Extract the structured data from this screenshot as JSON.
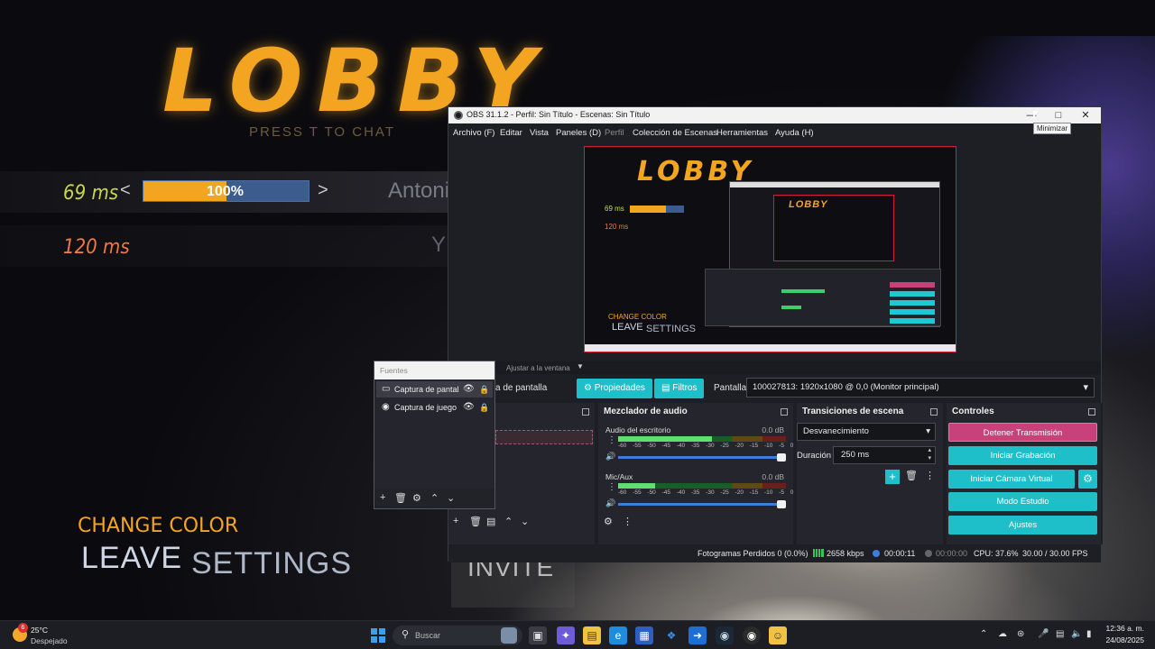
{
  "game": {
    "title": "LOBBY",
    "press_chat": "PRESS T TO CHAT",
    "ping1": "69 ms",
    "ping2": "120 ms",
    "volume_text": "100%",
    "volume_fraction": 0.5,
    "player1": "Antoni",
    "player2": "Y",
    "change_color": "CHANGE COLOR",
    "leave": "LEAVE",
    "settings": "SETTINGS",
    "invite": "INVITE",
    "accent_color": "#f3a521"
  },
  "obs": {
    "window_title": "OBS 31.1.2 - Perfil: Sin Título - Escenas: Sin Título",
    "menu": [
      "Archivo (F)",
      "Editar",
      "Vista",
      "Paneles (D)",
      "Perfil",
      "Colección de Escenas",
      "Herramientas",
      "Ayuda (H)"
    ],
    "tooltip": "Minimizar",
    "fit_label": "Ajustar a la ventana",
    "source_name_partial": "a de pantalla",
    "properties_btn": "Propiedades",
    "filters_btn": "Filtros",
    "pantalla_label": "Pantalla",
    "pantalla_value": "100027813: 1920x1080 @ 0,0 (Monitor principal)",
    "sources": {
      "title": "Fuentes",
      "items": [
        {
          "label": "Captura de pantal",
          "icon": "monitor-icon"
        },
        {
          "label": "Captura de juego",
          "icon": "gamepad-icon"
        }
      ]
    },
    "mixer": {
      "title": "Mezclador de audio",
      "scale": "-60 -55 -50 -45 -40 -35 -30 -25 -20 -15 -10 -5 0",
      "tracks": [
        {
          "name": "Audio del escritorio",
          "db": "0.0 dB",
          "level": 0.56
        },
        {
          "name": "Mic/Aux",
          "db": "0.0 dB",
          "level": 0.22
        }
      ]
    },
    "transitions": {
      "title": "Transiciones de escena",
      "selected": "Desvanecimiento",
      "duration_label": "Duración",
      "duration_value": "250 ms"
    },
    "controls": {
      "title": "Controles",
      "stop_stream": "Detener Transmisión",
      "start_recording": "Iniciar Grabación",
      "start_vcam": "Iniciar Cámara Virtual",
      "studio_mode": "Modo Estudio",
      "settings": "Ajustes",
      "teal": "#1fbfca",
      "pink": "#c9417a"
    },
    "status": {
      "dropped": "Fotogramas Perdidos 0 (0.0%)",
      "kbps": "2658 kbps",
      "stream_time": "00:00:11",
      "rec_time": "00:00:00",
      "cpu": "CPU: 37.6%",
      "fps": "30.00 / 30.00 FPS"
    }
  },
  "taskbar": {
    "weather_badge": "6",
    "temp": "25°C",
    "weather": "Despejado",
    "search": "Buscar",
    "time": "12:36 a. m.",
    "date": "24/08/2025"
  }
}
